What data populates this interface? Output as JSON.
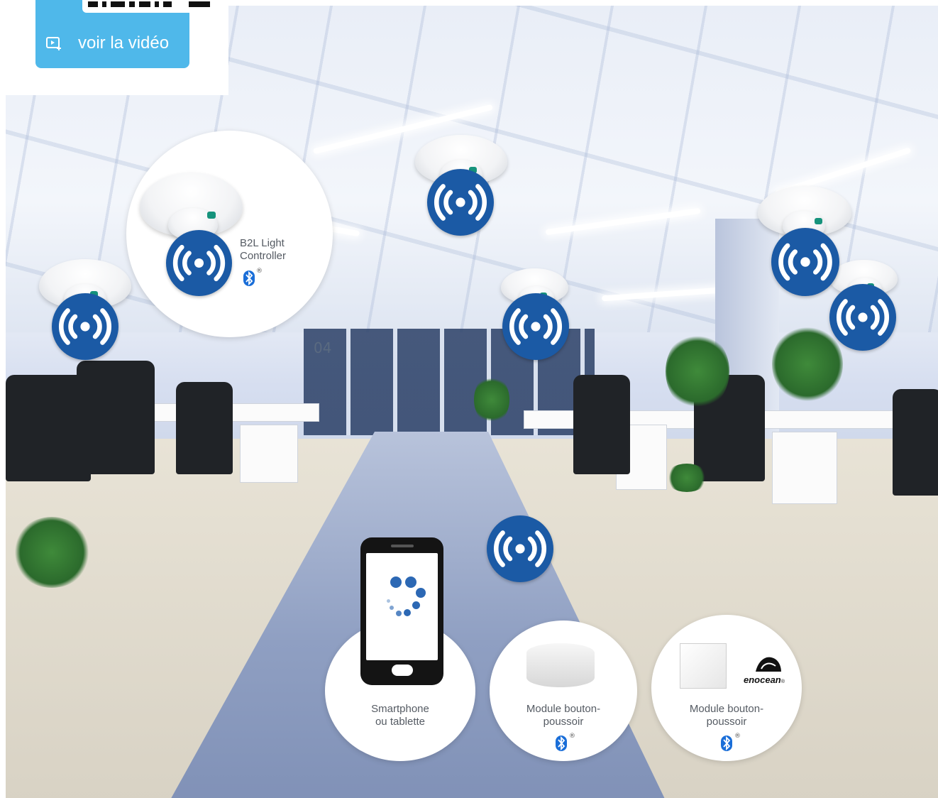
{
  "video_card": {
    "label": "voir la vidéo",
    "icon": "play-plus-icon",
    "accent": "#4fb8ea"
  },
  "scene": {
    "sign_number": "04"
  },
  "featured_controller": {
    "name_line1": "B2L Light",
    "name_line2": "Controller",
    "protocol_icon": "bluetooth-icon",
    "registered": "®"
  },
  "devices": [
    {
      "label_line1": "Smartphone",
      "label_line2": "ou tablette",
      "icon": "smartphone-icon"
    },
    {
      "label_line1": "Module bouton-",
      "label_line2": "poussoir",
      "protocol_icon": "bluetooth-icon",
      "registered": "®"
    },
    {
      "label_line1": "Module bouton-",
      "label_line2": "poussoir",
      "protocol_icon": "bluetooth-icon",
      "registered": "®",
      "brand": "enocean",
      "brand_mark": "®"
    }
  ],
  "colors": {
    "wireless_blue": "#1b5aa5",
    "bluetooth_blue": "#1a6ed8",
    "sensor_led": "#16937c"
  }
}
